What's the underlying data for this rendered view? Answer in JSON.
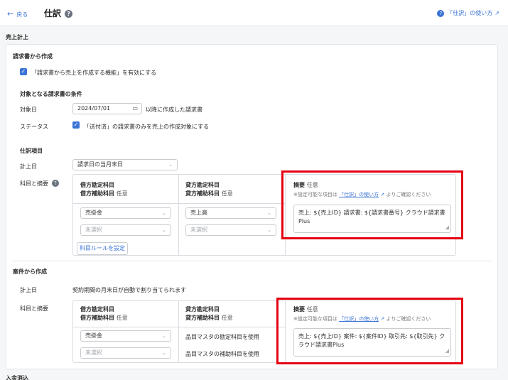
{
  "header": {
    "back_label": "戻る",
    "title": "仕訳",
    "help_link": "「仕訳」の使い方"
  },
  "section_title": "売上計上",
  "invoice": {
    "heading": "請求書から作成",
    "enable_label": "「請求書から売上を作成する機能」を有効にする",
    "conditions_heading": "対象となる請求書の条件",
    "target_date_label": "対象日",
    "target_date_value": "2024/07/01",
    "target_date_suffix": "以降に作成した請求書",
    "status_label": "ステータス",
    "status_check_label": "「送付済」の請求書のみを売上の作成対象にする",
    "journal_heading": "仕訳項目",
    "record_date_label": "計上日",
    "record_date_value": "請求日の当月末日",
    "accounts_label": "科目と摘要",
    "table": {
      "debit_header1": "借方勘定科目",
      "debit_header2": "借方補助科目",
      "credit_header1": "貸方勘定科目",
      "credit_header2": "貸方補助科目",
      "optional": "任意",
      "memo_header": "摘要",
      "memo_note_prefix": "※設定可能な項目は",
      "memo_note_link": "「仕訳」の使い方",
      "memo_note_suffix": "よりご確認ください",
      "debit_account": "売掛金",
      "debit_sub": "未選択",
      "credit_account": "売上高",
      "credit_sub": "未選択",
      "memo_value": "売上: ${売上ID} 請求書: ${請求書番号} クラウド請求書Plus"
    },
    "rule_button": "科目ルールを設定"
  },
  "project": {
    "heading": "案件から作成",
    "record_date_label": "計上日",
    "record_date_text": "契約期間の月末日が自動で割り当てられます",
    "accounts_label": "科目と摘要",
    "table": {
      "debit_header1": "借方勘定科目",
      "debit_header2": "借方補助科目",
      "credit_header1": "貸方勘定科目",
      "credit_header2": "貸方補助科目",
      "optional": "任意",
      "memo_header": "摘要",
      "memo_note_prefix": "※設定可能な項目は",
      "memo_note_link": "「仕訳」の使い方",
      "memo_note_suffix": "よりご確認ください",
      "debit_account": "売掛金",
      "debit_sub": "未選択",
      "credit_account_text": "品目マスタの勘定科目を使用",
      "credit_sub_text": "品目マスタの補助科目を使用",
      "memo_value": "売上: ${売上ID} 案件: ${案件ID} 取引先: ${取引先} クラウド請求書Plus"
    }
  },
  "next_section_partial": "入金消込",
  "colors": {
    "accent": "#3b73d6",
    "highlight": "#e50012"
  }
}
